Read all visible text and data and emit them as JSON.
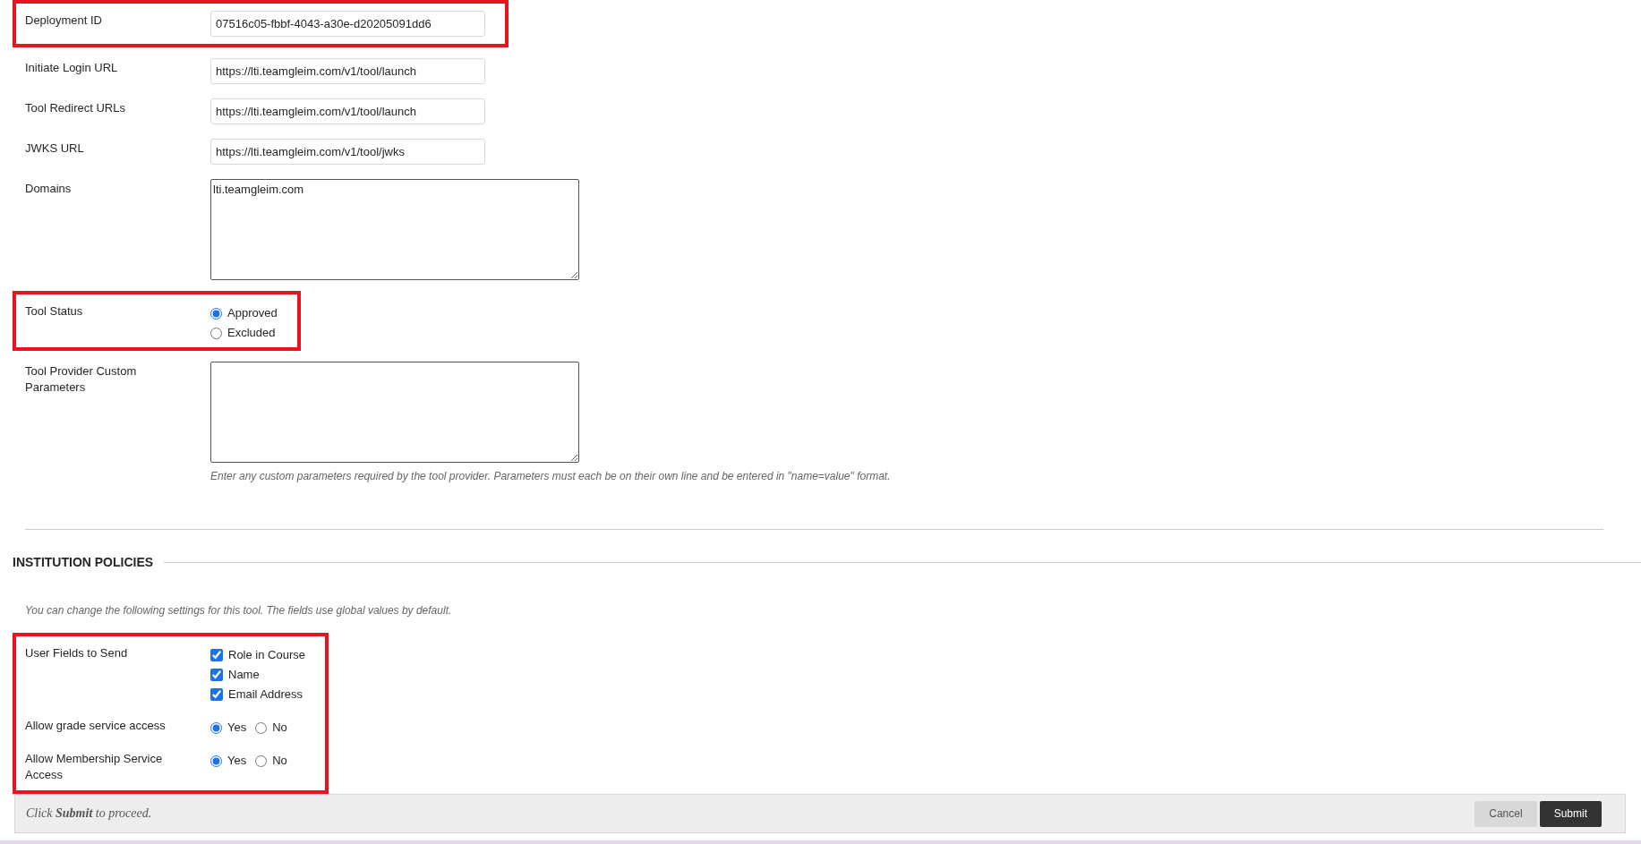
{
  "tool_fields": [
    {
      "highlighted": true,
      "fields": [
        {
          "kind": "text",
          "label": "Deployment ID",
          "value": "07516c05-fbbf-4043-a30e-d20205091dd6"
        }
      ]
    },
    {
      "highlighted": false,
      "fields": [
        {
          "kind": "text",
          "label": "Initiate Login URL",
          "value": "https://lti.teamgleim.com/v1/tool/launch"
        },
        {
          "kind": "text",
          "label": "Tool Redirect URLs",
          "value": "https://lti.teamgleim.com/v1/tool/launch"
        },
        {
          "kind": "text",
          "label": "JWKS URL",
          "value": "https://lti.teamgleim.com/v1/tool/jwks"
        },
        {
          "kind": "textarea",
          "label": "Domains",
          "value": "lti.teamgleim.com"
        }
      ]
    },
    {
      "highlighted": true,
      "fields": [
        {
          "kind": "radio_stack",
          "label": "Tool Status",
          "options": [
            {
              "label": "Approved",
              "selected": true
            },
            {
              "label": "Excluded",
              "selected": false
            }
          ]
        }
      ]
    },
    {
      "highlighted": false,
      "fields": [
        {
          "kind": "textarea",
          "label": "Tool Provider Custom Parameters",
          "help": "Enter any custom parameters required by the tool provider. Parameters must each be on their own line and be entered in \"name=value\" format."
        }
      ]
    }
  ],
  "section": {
    "title": "INSTITUTION POLICIES",
    "description": "You can change the following settings for this tool. The fields use global values by default."
  },
  "policy_fields": [
    {
      "highlighted": true,
      "fields": [
        {
          "kind": "checkbox",
          "label": "User Fields to Send",
          "options": [
            {
              "label": "Role in Course",
              "checked": true
            },
            {
              "label": "Name",
              "checked": true
            },
            {
              "label": "Email Address",
              "checked": true
            }
          ]
        },
        {
          "kind": "radio_row",
          "label": "Allow grade service access",
          "options": [
            {
              "label": "Yes",
              "selected": true
            },
            {
              "label": "No",
              "selected": false
            }
          ]
        },
        {
          "kind": "radio_row",
          "label": "Allow Membership Service Access",
          "options": [
            {
              "label": "Yes",
              "selected": true
            },
            {
              "label": "No",
              "selected": false
            }
          ]
        }
      ]
    }
  ],
  "footer": {
    "instruction": "Click **Submit** to proceed.",
    "buttons": [
      {
        "label": "Cancel",
        "kind": "secondary"
      },
      {
        "label": "Submit",
        "kind": "primary"
      }
    ]
  }
}
